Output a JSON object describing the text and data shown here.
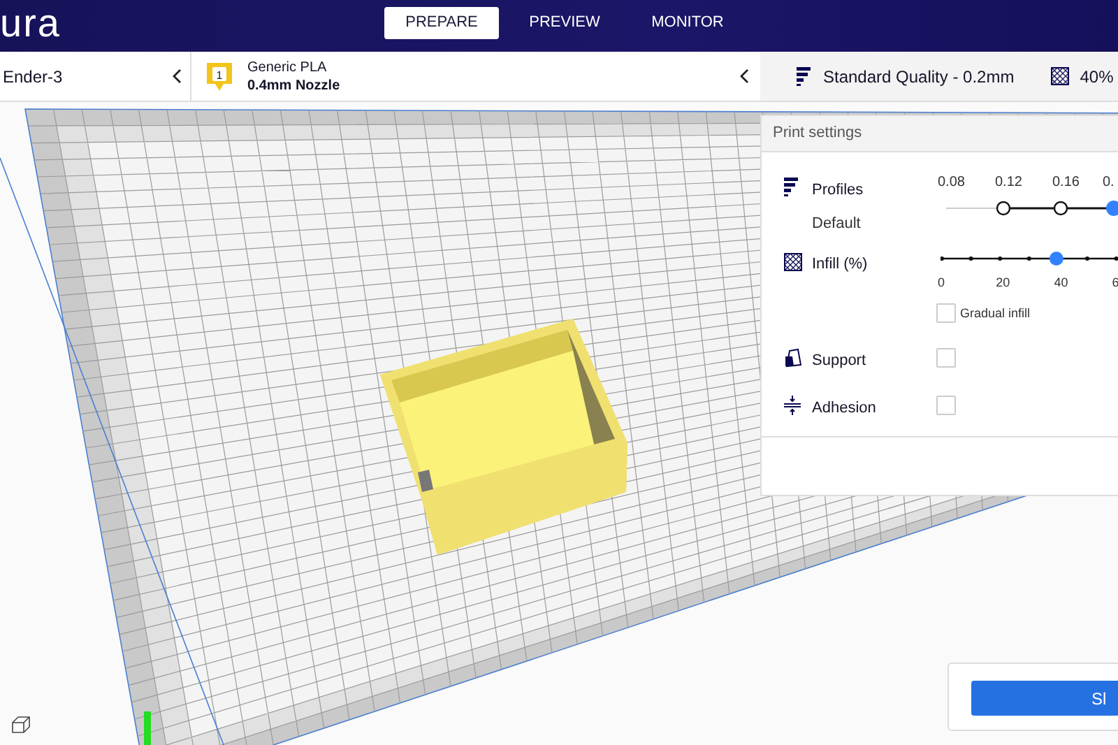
{
  "app_title": "ura",
  "stage_tabs": [
    {
      "label": "PREPARE",
      "selected": true
    },
    {
      "label": "PREVIEW",
      "selected": false
    },
    {
      "label": "MONITOR",
      "selected": false
    }
  ],
  "printer": {
    "name": "Ender-3"
  },
  "extruder": {
    "number": "1",
    "material": "Generic PLA",
    "nozzle": "0.4mm Nozzle"
  },
  "settings_summary": {
    "quality": "Standard Quality - 0.2mm",
    "infill": "40%"
  },
  "print_settings": {
    "title": "Print settings",
    "profiles": {
      "label": "Profiles",
      "profile": "Default",
      "layer_heights": [
        {
          "label": "0.08",
          "available": false,
          "selected": false
        },
        {
          "label": "0.12",
          "available": true,
          "selected": false
        },
        {
          "label": "0.16",
          "available": true,
          "selected": false
        },
        {
          "label": "0.",
          "available": true,
          "selected": true
        }
      ]
    },
    "infill": {
      "label": "Infill (%)",
      "level": 0.65,
      "ticks": [
        "0",
        "20",
        "40",
        "6"
      ],
      "gradual": {
        "label": "Gradual infill",
        "checked": false
      }
    },
    "support": {
      "label": "Support",
      "checked": false
    },
    "adhesion": {
      "label": "Adhesion",
      "checked": false
    }
  },
  "slice_button": {
    "label": "Sl"
  }
}
